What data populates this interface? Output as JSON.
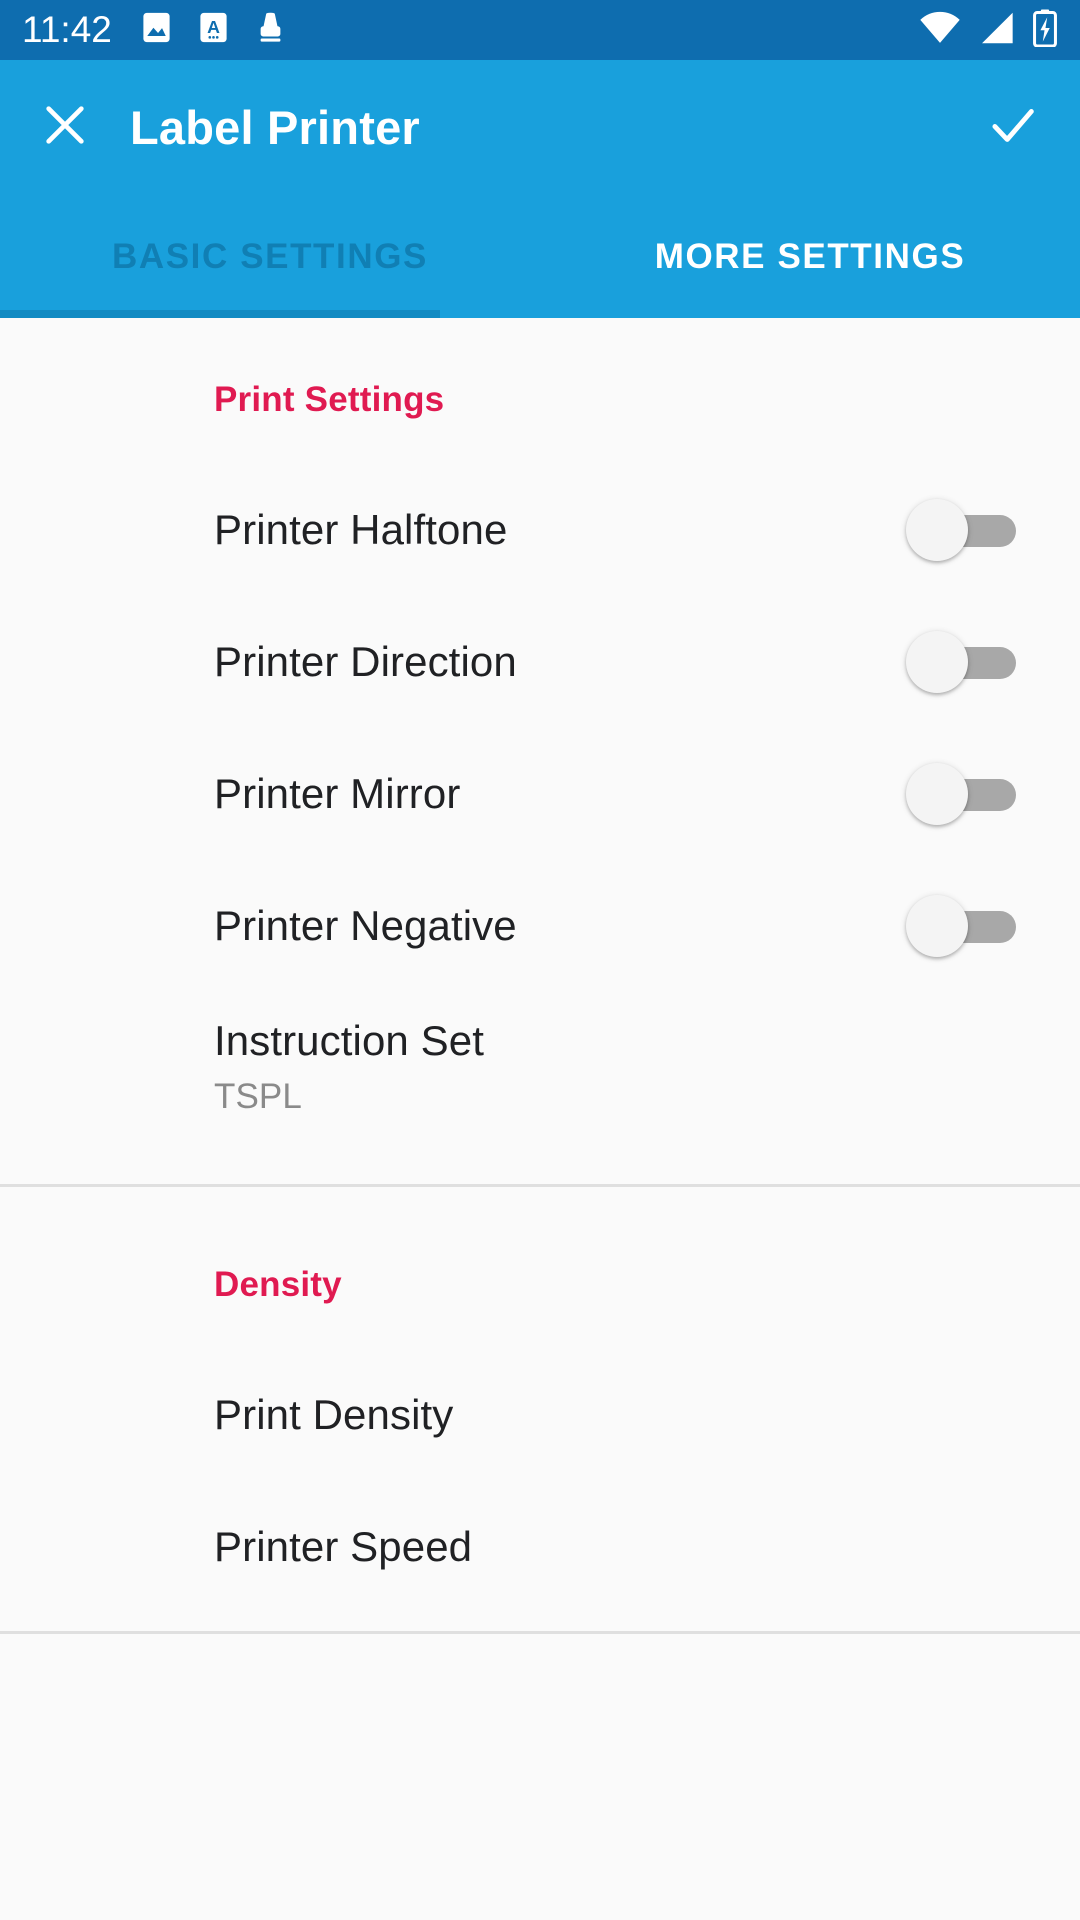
{
  "status_bar": {
    "time": "11:42",
    "left_icons": [
      {
        "name": "image-icon",
        "label": "screenshot"
      },
      {
        "name": "translate-icon",
        "label": "A"
      },
      {
        "name": "printer-icon",
        "label": "printer"
      }
    ],
    "right_icons": [
      {
        "name": "wifi-icon",
        "label": "wifi-full"
      },
      {
        "name": "cellular-signal-icon",
        "label": "signal"
      },
      {
        "name": "battery-charging-icon",
        "label": "battery-charging"
      }
    ],
    "background_color": "#0E6DAF"
  },
  "app_bar": {
    "title": "Label Printer",
    "close_icon": "close-icon",
    "confirm_icon": "check-icon",
    "background_color": "#19A0DC"
  },
  "tabs": {
    "items": [
      {
        "label": "BASIC SETTINGS",
        "active": false
      },
      {
        "label": "MORE SETTINGS",
        "active": true
      }
    ],
    "indicator_color": "#0E6DAF"
  },
  "content": {
    "accent_color": "#E01A51",
    "background_color": "#FAFAFA",
    "sections": [
      {
        "header": "Print Settings",
        "rows": [
          {
            "title": "Printer Halftone",
            "control": "switch",
            "value": "off"
          },
          {
            "title": "Printer Direction",
            "control": "switch",
            "value": "off"
          },
          {
            "title": "Printer Mirror",
            "control": "switch",
            "value": "off"
          },
          {
            "title": "Printer Negative",
            "control": "switch",
            "value": "off"
          },
          {
            "title": "Instruction Set",
            "subtitle": "TSPL",
            "control": "none"
          }
        ]
      },
      {
        "header": "Density",
        "rows": [
          {
            "title": "Print Density",
            "control": "none"
          },
          {
            "title": "Printer Speed",
            "control": "none"
          }
        ]
      }
    ]
  }
}
